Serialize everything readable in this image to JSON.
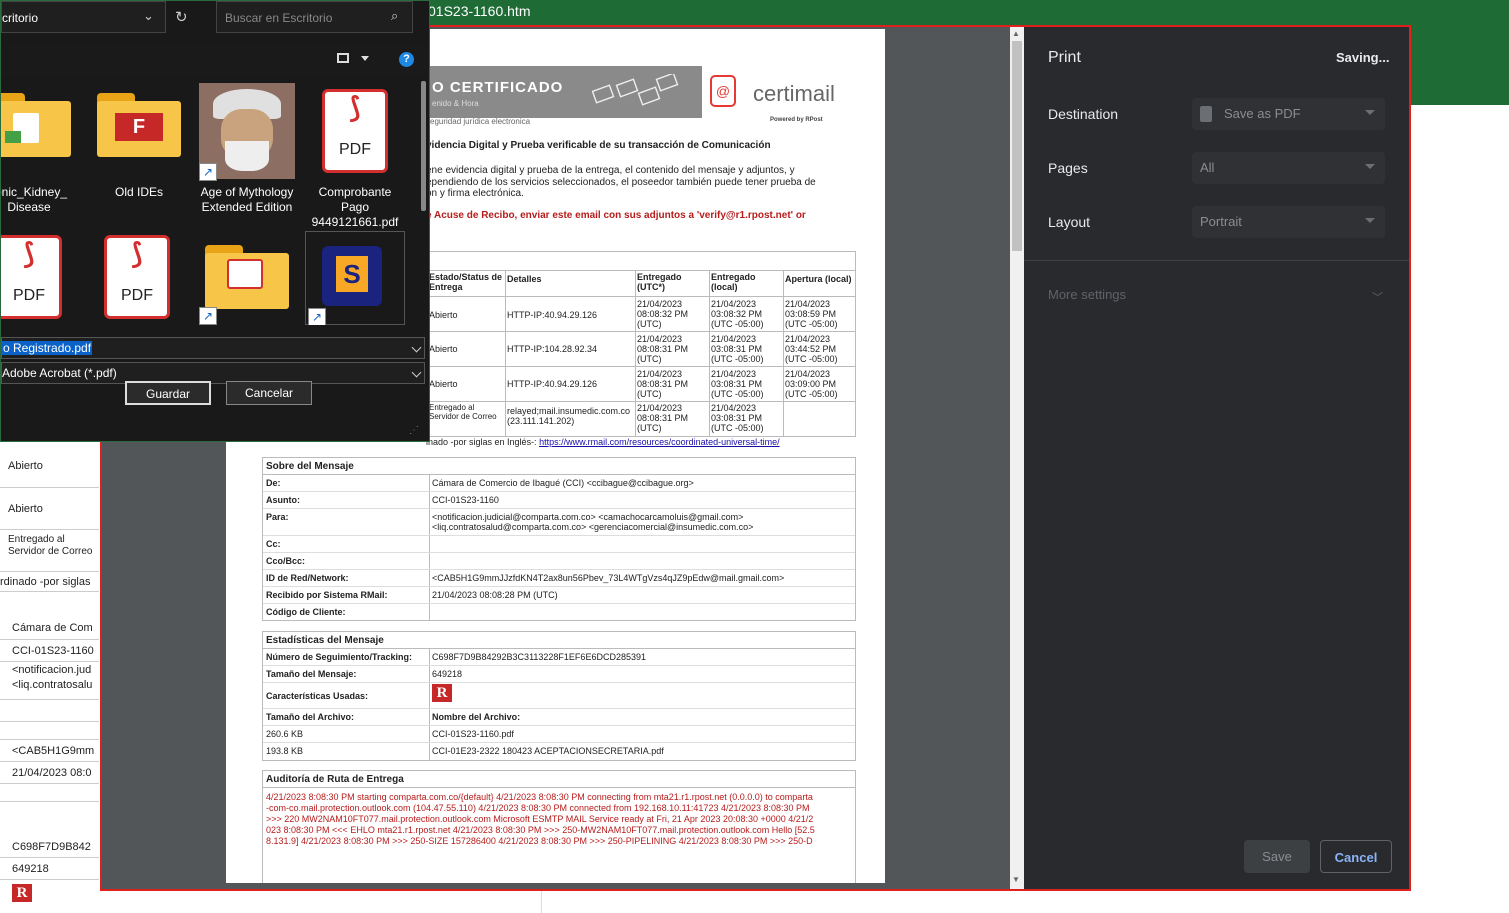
{
  "background": {
    "window_title": "01S23-1160.htm",
    "left_cells": [
      {
        "text": "Abierto"
      },
      {
        "text": "Abierto"
      },
      {
        "text": "Entregado al Servidor de Correo"
      },
      {
        "text": "rdinado -por siglas"
      },
      {
        "text": "Cámara de Com"
      },
      {
        "text": "CCI-01S23-1160"
      },
      {
        "text": "<notificacion.jud"
      },
      {
        "text": "<liq.contratosalu"
      },
      {
        "text": "<CAB5H1G9mm"
      },
      {
        "text": "21/04/2023 08:0"
      },
      {
        "text": "C698F7D9B842"
      },
      {
        "text": "649218"
      }
    ]
  },
  "file_dialog": {
    "path_label": "critorio",
    "search_placeholder": "Buscar en Escritorio",
    "view_icon": "view-icon",
    "help_icon": "help-icon",
    "files": [
      {
        "label": "ronic_Kidney_ Disease",
        "icon": "folder-icon"
      },
      {
        "label": "Old IDEs",
        "icon": "folder-icon"
      },
      {
        "label": "Age of Mythology Extended Edition",
        "icon": "game-icon"
      },
      {
        "label": "Comprobante Pago 9449121661.pdf",
        "icon": "pdf-icon"
      },
      {
        "label": "",
        "icon": "pdf-icon"
      },
      {
        "label": "",
        "icon": "pdf-icon"
      },
      {
        "label": "",
        "icon": "folder-icon"
      },
      {
        "label": "",
        "icon": "game-icon"
      }
    ],
    "pdf_text": "PDF",
    "filename_value": "o Registrado.pdf",
    "filetype_value": "Adobe Acrobat (*.pdf)",
    "save_label": "Guardar",
    "cancel_label": "Cancelar"
  },
  "print_dialog": {
    "title": "Print",
    "status": "Saving...",
    "destination_label": "Destination",
    "destination_value": "Save as PDF",
    "pages_label": "Pages",
    "pages_value": "All",
    "layout_label": "Layout",
    "layout_value": "Portrait",
    "more_settings_label": "More settings",
    "save_button": "Save",
    "cancel_button": "Cancel"
  },
  "preview": {
    "banner_text": "O CERTIFICADO",
    "banner_sub": "enido & Hora",
    "banner_sub2": "seguridad jurídica electronica",
    "brand": "certimail",
    "brand_sub": "Powered by RPost",
    "heading": "videncia Digital y Prueba verificable de su transacción de Comunicación",
    "intro_lines": [
      "ene evidencia digital y prueba de la entrega, el contenido del mensaje y adjuntos, y",
      "ependiendo de los servicios seleccionados, el poseedor también puede tener prueba de",
      "ón y firma electrónica."
    ],
    "verify_line": "e Acuse de Recibo, enviar este email con sus adjuntos a 'verify@r1.rpost.net' or",
    "delivery_headers": [
      "Estado/Status de Entrega",
      "Detalles",
      "Entregado (UTC*)",
      "Entregado (local)",
      "Apertura (local)"
    ],
    "delivery_rows": [
      [
        "Abierto",
        "HTTP-IP:40.94.29.126",
        "21/04/2023 08:08:32 PM (UTC)",
        "21/04/2023 03:08:32 PM (UTC -05:00)",
        "21/04/2023 03:08:59 PM (UTC -05:00)"
      ],
      [
        "Abierto",
        "HTTP-IP:104.28.92.34",
        "21/04/2023 08:08:31 PM (UTC)",
        "21/04/2023 03:08:31 PM (UTC -05:00)",
        "21/04/2023 03:44:52 PM (UTC -05:00)"
      ],
      [
        "Abierto",
        "HTTP-IP:40.94.29.126",
        "21/04/2023 08:08:31 PM (UTC)",
        "21/04/2023 03:08:31 PM (UTC -05:00)",
        "21/04/2023 03:09:00 PM (UTC -05:00)"
      ],
      [
        "Entregado al Servidor de Correo",
        "relayed;mail.insumedic.com.co (23.111.141.202)",
        "21/04/2023 08:08:31 PM (UTC)",
        "21/04/2023 03:08:31 PM (UTC -05:00)",
        ""
      ]
    ],
    "utc_note": "inado -por siglas en Inglés-: ",
    "utc_link": "https://www.rmail.com/resources/coordinated-universal-time/",
    "message_title": "Sobre del Mensaje",
    "message_rows": [
      [
        "De:",
        "Cámara de Comercio de Ibagué (CCI) <ccibague@ccibague.org>"
      ],
      [
        "Asunto:",
        "CCI-01S23-1160"
      ],
      [
        "Para:",
        "<notificacion.judicial@comparta.com.co> <camachocarcamoluis@gmail.com> <liq.contratosalud@comparta.com.co> <gerenciacomercial@insumedic.com.co>"
      ],
      [
        "Cc:",
        ""
      ],
      [
        "Cco/Bcc:",
        ""
      ],
      [
        "ID de Red/Network:",
        "<CAB5H1G9mmJJzfdKN4T2ax8un56Pbev_73L4WTgVzs4qJZ9pEdw@mail.gmail.com>"
      ],
      [
        "Recibido por Sistema RMail:",
        "21/04/2023 08:08:28 PM (UTC)"
      ],
      [
        "Código de Cliente:",
        ""
      ]
    ],
    "stats_title": "Estadísticas del Mensaje",
    "stats_rows": [
      [
        "Número de Seguimiento/Tracking:",
        "C698F7D9B84292B3C3113228F1EF6E6DCD285391"
      ],
      [
        "Tamaño del Mensaje:",
        "649218"
      ],
      [
        "Características Usadas:",
        ""
      ],
      [
        "Tamaño del Archivo:",
        "Nombre del Archivo:"
      ],
      [
        "260.6 KB",
        "CCI-01S23-1160.pdf"
      ],
      [
        "193.8 KB",
        "CCI-01E23-2322 180423 ACEPTACIONSECRETARIA.pdf"
      ]
    ],
    "audit_title": "Auditoría de Ruta de Entrega",
    "audit_lines": [
      "4/21/2023 8:08:30 PM starting comparta.com.co/{default} 4/21/2023 8:08:30 PM connecting from mta21.r1.rpost.net (0.0.0.0) to comparta",
      "-com-co.mail.protection.outlook.com (104.47.55.110) 4/21/2023 8:08:30 PM connected from 192.168.10.11:41723 4/21/2023 8:08:30 PM",
      ">>> 220 MW2NAM10FT077.mail.protection.outlook.com Microsoft ESMTP MAIL Service ready at Fri, 21 Apr 2023 20:08:30 +0000 4/21/2",
      "023 8:08:30 PM <<< EHLO mta21.r1.rpost.net 4/21/2023 8:08:30 PM >>> 250-MW2NAM10FT077.mail.protection.outlook.com Hello [52.5",
      "8.131.9] 4/21/2023 8:08:30 PM >>> 250-SIZE 157286400 4/21/2023 8:08:30 PM >>> 250-PIPELINING 4/21/2023 8:08:30 PM >>> 250-D"
    ],
    "rpost_mark": "R"
  }
}
